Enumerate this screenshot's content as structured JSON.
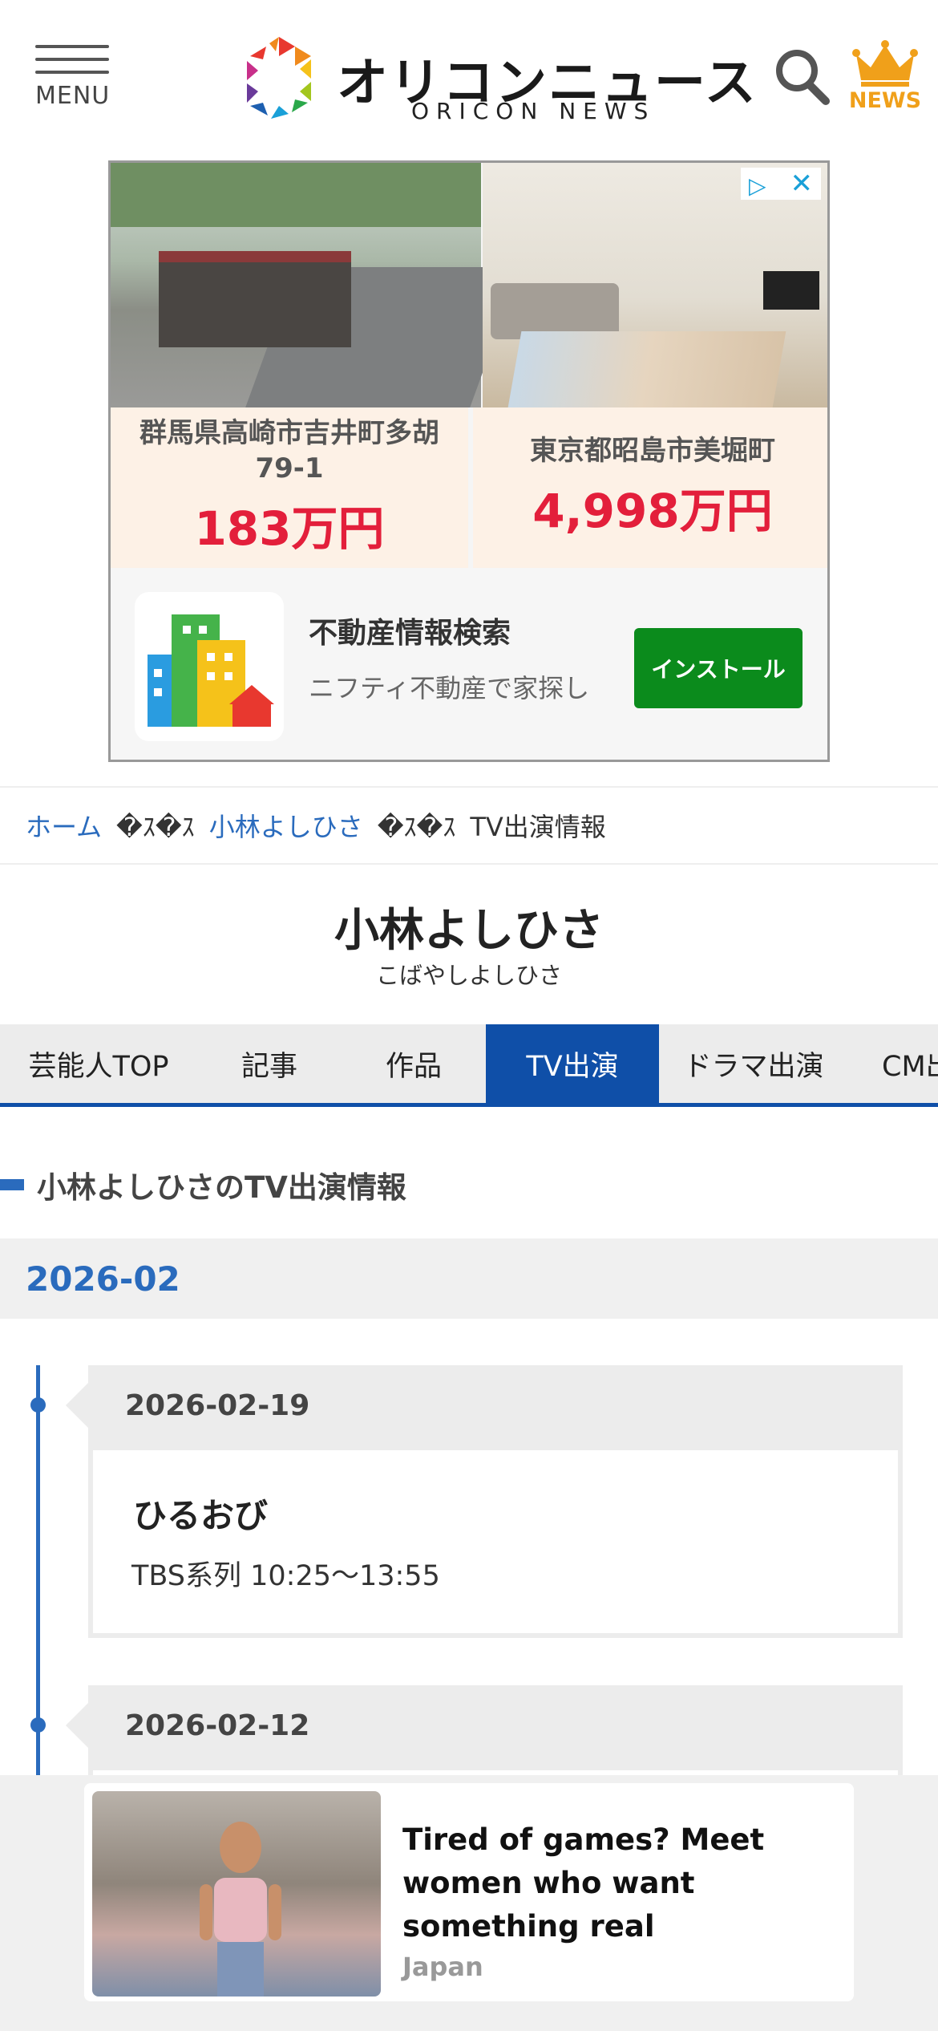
{
  "header": {
    "menu_label": "MENU",
    "logo_jp": "オリコンニュース",
    "logo_en": "ORICON NEWS",
    "news_label": "NEWS",
    "accent_color": "#f0a01a"
  },
  "ad": {
    "listings": [
      {
        "address": "群馬県高崎市吉井町多胡 79-1",
        "price": "183万円"
      },
      {
        "address": "東京都昭島市美堀町",
        "price": "4,998万円"
      }
    ],
    "app_title": "不動産情報検索",
    "app_subtitle": "ニフティ不動産で家探し",
    "install_label": "インストール"
  },
  "breadcrumb": {
    "home": "ホーム",
    "separator": "�ｽ�ｽ",
    "person": "小林よしひさ",
    "current": "TV出演情報"
  },
  "person": {
    "name": "小林よしひさ",
    "kana": "こばやしよしひさ"
  },
  "tabs": [
    {
      "label": "芸能人TOP",
      "active": false
    },
    {
      "label": "記事",
      "active": false
    },
    {
      "label": "作品",
      "active": false
    },
    {
      "label": "TV出演",
      "active": true
    },
    {
      "label": "ドラマ出演",
      "active": false
    },
    {
      "label": "CM出演",
      "active": false
    }
  ],
  "section": {
    "heading": "小林よしひさのTV出演情報"
  },
  "month": "2026-02",
  "entries": [
    {
      "date": "2026-02-19",
      "program": "ひるおび",
      "channel": "TBS系列 10:25～13:55"
    },
    {
      "date": "2026-02-12"
    }
  ],
  "sticky_ad": {
    "title": "Tired of games? Meet women who want something real",
    "source": "Japan"
  },
  "colors": {
    "brand_blue": "#0f4fa8",
    "link_blue": "#2a6bbd",
    "price_red": "#e31f3b",
    "install_green": "#0b8b1c"
  }
}
